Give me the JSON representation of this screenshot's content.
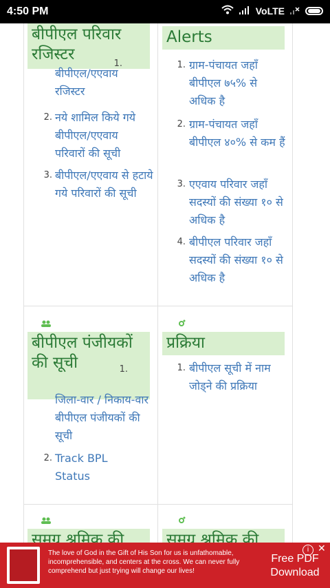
{
  "status": {
    "time": "4:50 PM",
    "network": "VoLTE"
  },
  "sections": [
    {
      "title": "बीपीएल परिवार रजिस्टर",
      "items": [
        {
          "num": "1.",
          "text": "बीपीएल/एएवाय रजिस्टर"
        },
        {
          "num": "2.",
          "text": "नये शामिल किये गये बीपीएल/एएवाय परिवारों की सूची"
        },
        {
          "num": "3.",
          "text": "बीपीएल/एएवाय से हटाये गये परिवारों की सूची"
        }
      ]
    },
    {
      "title": "Alerts",
      "items": [
        {
          "num": "1.",
          "text": "ग्राम-पंचायत जहाँ बीपीएल ७५% से अधिक है"
        },
        {
          "num": "2.",
          "text": "ग्राम-पंचायत जहाँ बीपीएल ४०% से कम हैं"
        },
        {
          "num": "3.",
          "text": "एएवाय परिवार जहाँ सदस्यों की संख्या १० से अधिक है"
        },
        {
          "num": "4.",
          "text": "बीपीएल परिवार जहाँ सदस्यों की संख्या १० से अधिक है"
        }
      ]
    },
    {
      "title": "बीपीएल पंजीयकों की सूची",
      "items": [
        {
          "num": "1.",
          "text": "जिला-वार / निकाय-वार बीपीएल पंजीयकों की सूची"
        },
        {
          "num": "2.",
          "text": "Track BPL Status"
        }
      ]
    },
    {
      "title": "प्रक्रिया",
      "items": [
        {
          "num": "1.",
          "text": "बीपीएल सूची में नाम जोड्ने की प्रक्रिया"
        }
      ]
    },
    {
      "title": "समग्र श्रमिक की"
    },
    {
      "title": "समग्र श्रमिक की"
    }
  ],
  "ad": {
    "text": "The love of God in the Gift of His Son for us is unfathomable, incomprehensible, and centers at the cross. We can never fully comprehend but just trying will change our lives!",
    "button": "Free PDF Download"
  }
}
